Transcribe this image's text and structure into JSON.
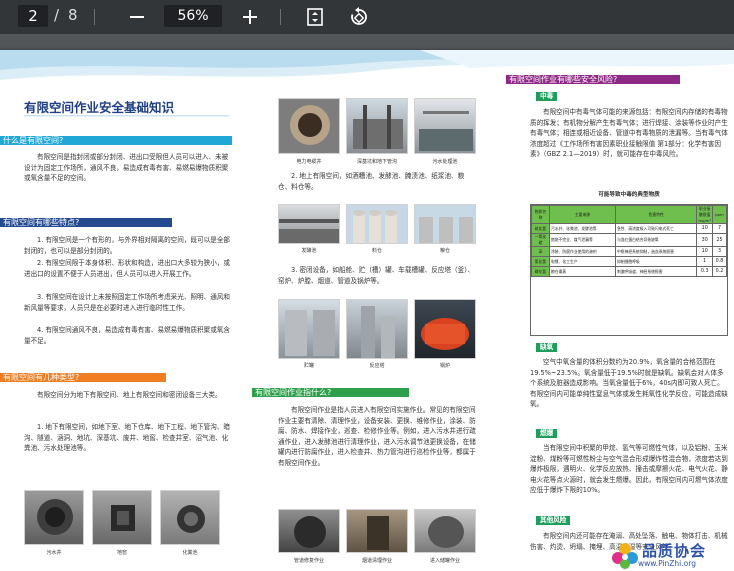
{
  "toolbar": {
    "current_page": "2",
    "separator": "/",
    "total_pages": "8",
    "zoom": "56%"
  },
  "doc": {
    "title": "有限空间作业安全基础知识",
    "left": {
      "h1": "什么是有限空间?",
      "p1": "有限空间是指封闭或部分封闭、进出口受限但人员可以进入、未被设计为固定工作场所，通风不良，易造成有毒有害、易燃易爆物质积聚或氧含量不足的空间。",
      "h2": "有限空间有哪些特点?",
      "p2a": "1. 有限空间是一个有形的，与外界相对隔离的空间，既可以是全部封闭的，也可以是部分封闭的。",
      "p2b": "2. 有限空间限于本身体积、形状和构造，进出口大多较为狭小，或进出口的设置不便于人员进出，但人员可以进入开展工作。",
      "p2c": "3. 有限空间在设计上未按照固定工作场所考虑采光、照明、通风和新风量等要求，人员只是在必要时进入进行临时性工作。",
      "p2d": "4. 有限空间通风不良，易造成有毒有害、易燃易爆物质积聚或氧含量不足。",
      "h3": "有限空间有几种类型?",
      "p3a": "有限空间分为地下有限空间、地上有限空间和密闭设备三大类。",
      "p3b": "1. 地下有限空间，如地下室、地下仓库、地下工程、地下管沟、暗沟、隧道、涵洞、地坑、深基坑、废井、地窖、检查井室、沼气池、化粪池、污水处理池等。",
      "captions": [
        "污水井",
        "地窖",
        "化粪池"
      ]
    },
    "middle": {
      "captions_top": [
        "电力电缆井",
        "深基坑和地下管沟",
        "污水处理池"
      ],
      "p2": "2. 地上有限空间，如酒糟池、发酵池、腌渍池、纸浆池、粮仓、料仓等。",
      "captions_mid": [
        "发酵池",
        "料仓",
        "粮仓"
      ],
      "p3": "3. 密闭设备，如船舱、贮（槽）罐、车载槽罐、反应塔（釜）、窑炉、炉膛、烟道、管道及锅炉等。",
      "captions_low": [
        "贮罐",
        "反应塔",
        "锅炉"
      ],
      "h4": "有限空间作业指什么?",
      "p4": "有限空间作业是指人员进入有限空间实施作业。常见的有限空间作业主要有清除、清理作业，设备安装、更换、维修作业，涂装、防腐、防水、焊接作业，巡查、检修作业等。例如，进入污水井进行疏通作业，进入发酵池进行清理作业，进入污水调节池更换设备，在储罐内进行防腐作业，进入检查井、热力管沟进行巡检作业等，都属于有限空间作业。",
      "captions_bottom": [
        "管道修复作业",
        "烟道清理作业",
        "进入储罐作业"
      ]
    },
    "right": {
      "h5": "有限空间作业有哪些安全风险?",
      "tag1": "中毒",
      "p5": "有限空间中有毒气体可能的来源包括：有限空间内存储的有毒物质的挥发；有机物分解产生有毒气体；进行焊接、涂装等作业时产生有毒气体；相连或相近设备、管道中有毒物质的泄漏等。当有毒气体浓度超过《工作场所有害因素职业接触限值 第1部分：化学有害因素》（GBZ 2.1—2019）时，就可能存在中毒风险。",
      "table_title": "可能导致中毒的典型物质",
      "table": {
        "headers": [
          "物质名称",
          "主要来源",
          "危害特性",
          "职业接触限值 mg/m³",
          "ppm"
        ],
        "rows": [
          {
            "name": "硫化氢",
            "src": "污水井、化粪池、发酵池等",
            "hz": "急性、高浓度吸入可致闪电式死亡",
            "v1": "10",
            "v2": "7"
          },
          {
            "name": "一氧化碳",
            "src": "燃烧不完全、煤气泄漏等",
            "hz": "与血红蛋白结合导致缺氧",
            "v1": "30",
            "v2": "25"
          },
          {
            "name": "苯",
            "src": "涂装、防腐作业使用的溶剂",
            "hz": "中枢神经系统抑制，造血系统损害",
            "v1": "10",
            "v2": "3"
          },
          {
            "name": "氰化氢",
            "src": "电镀、化工生产",
            "hz": "抑制细胞呼吸",
            "v1": "1",
            "v2": "0.8"
          },
          {
            "name": "磷化氢",
            "src": "粮仓熏蒸",
            "hz": "刺激呼吸道、神经系统损害",
            "v1": "0.3",
            "v2": "0.2"
          }
        ]
      },
      "tag2": "缺氧",
      "p6": "空气中氧含量的体积分数约为20.9%，氧含量的合格范围在19.5%~23.5%。氧含量低于19.5%时就是缺氧。缺氧会对人体多个系统及脏器造成影响。当氧含量低于6%，40s内即可致人死亡。有限空间内可能单纯性窒息气体或发生耗氧性化学反应，可能造成缺氧。",
      "tag3": "燃爆",
      "p7": "当有限空间中积聚的甲烷、氢气等可燃性气体，以及铝粉、玉米淀粉、煤粉等可燃性粉尘与空气混合形成爆炸性混合物，浓度若达到爆炸极限，遇明火、化学反应放热、撞击或摩擦火花、电气火花、静电火花等点火源时，就会发生燃爆。因此，有限空间内可燃气体浓度应低于爆炸下限的10%。",
      "tag4": "其他风险",
      "p8": "有限空间内还可能存在淹溺、高处坠落、触电、物体打击、机械伤害、灼烫、坍塌、掩埋、高温高湿等安全风险。"
    }
  },
  "watermark": {
    "name": "品质协会",
    "url": "www.PinZhi.org"
  },
  "colors": {
    "toolbar_bg": "#323639",
    "viewer_bg": "#525659",
    "heading_blue": "#1f3f86",
    "bar_cyan": "#21a7d6",
    "bar_navy": "#244a8f",
    "bar_orange": "#ef7d22",
    "bar_green": "#2ea04b",
    "bar_purple": "#8e2a86",
    "tag_green": "#1f9d5c"
  }
}
